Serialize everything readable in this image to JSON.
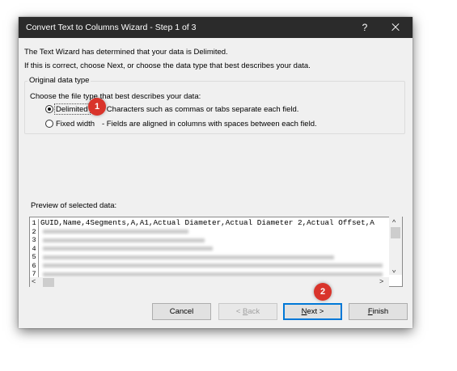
{
  "window": {
    "title": "Convert Text to Columns Wizard - Step 1 of 3",
    "help": "?"
  },
  "intro": {
    "line1": "The Text Wizard has determined that your data is Delimited.",
    "line2": "If this is correct, choose Next, or choose the data type that best describes your data."
  },
  "original_data_type": {
    "legend": "Original data type",
    "prompt": "Choose the file type that best describes your data:",
    "options": [
      {
        "label": "Delimited",
        "description": "- Characters such as commas or tabs separate each field.",
        "selected": true
      },
      {
        "label": "Fixed width",
        "description": "- Fields are aligned in columns with spaces between each field.",
        "selected": false
      }
    ]
  },
  "preview": {
    "label": "Preview of selected data:",
    "rows": [
      {
        "num": "1",
        "text": "GUID,Name,4Segments,A,A1,Actual Diameter,Actual Diameter 2,Actual Offset,A"
      },
      {
        "num": "2",
        "text": ""
      },
      {
        "num": "3",
        "text": ""
      },
      {
        "num": "4",
        "text": ""
      },
      {
        "num": "5",
        "text": ""
      },
      {
        "num": "6",
        "text": ""
      },
      {
        "num": "7",
        "text": ""
      }
    ]
  },
  "buttons": {
    "cancel": "Cancel",
    "back_prefix": "< ",
    "back_key": "B",
    "back_rest": "ack",
    "next_key": "N",
    "next_rest": "ext >",
    "finish_key": "F",
    "finish_rest": "inish"
  },
  "annotations": {
    "badge1": "1",
    "badge2": "2",
    "badge_color": "#d9342b"
  }
}
